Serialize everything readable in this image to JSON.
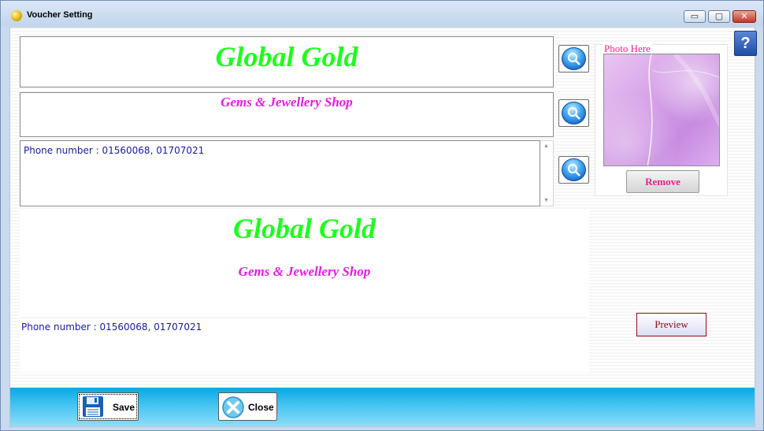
{
  "window": {
    "title": "Voucher Setting",
    "min_glyph": "▭",
    "max_glyph": "▢",
    "close_glyph": "✕"
  },
  "help": {
    "label": "?"
  },
  "editor": {
    "company_name": "Global Gold",
    "company_tagline": "Gems & Jewellery Shop",
    "address_text": "Phone number : 01560068, 01707021"
  },
  "photo": {
    "label": "Photo Here",
    "remove_label": "Remove"
  },
  "preview": {
    "company_name": "Global Gold",
    "company_tagline": "Gems & Jewellery Shop",
    "address_text": "Phone number : 01560068, 01707021",
    "button_label": "Preview"
  },
  "footer": {
    "save_label": "Save",
    "close_label": "Close"
  },
  "colors": {
    "company_name": "#1eff1e",
    "tagline": "#e21de2",
    "address": "#1a1aa0",
    "accent": "#e2248c",
    "footer": "#0aa6e4"
  }
}
